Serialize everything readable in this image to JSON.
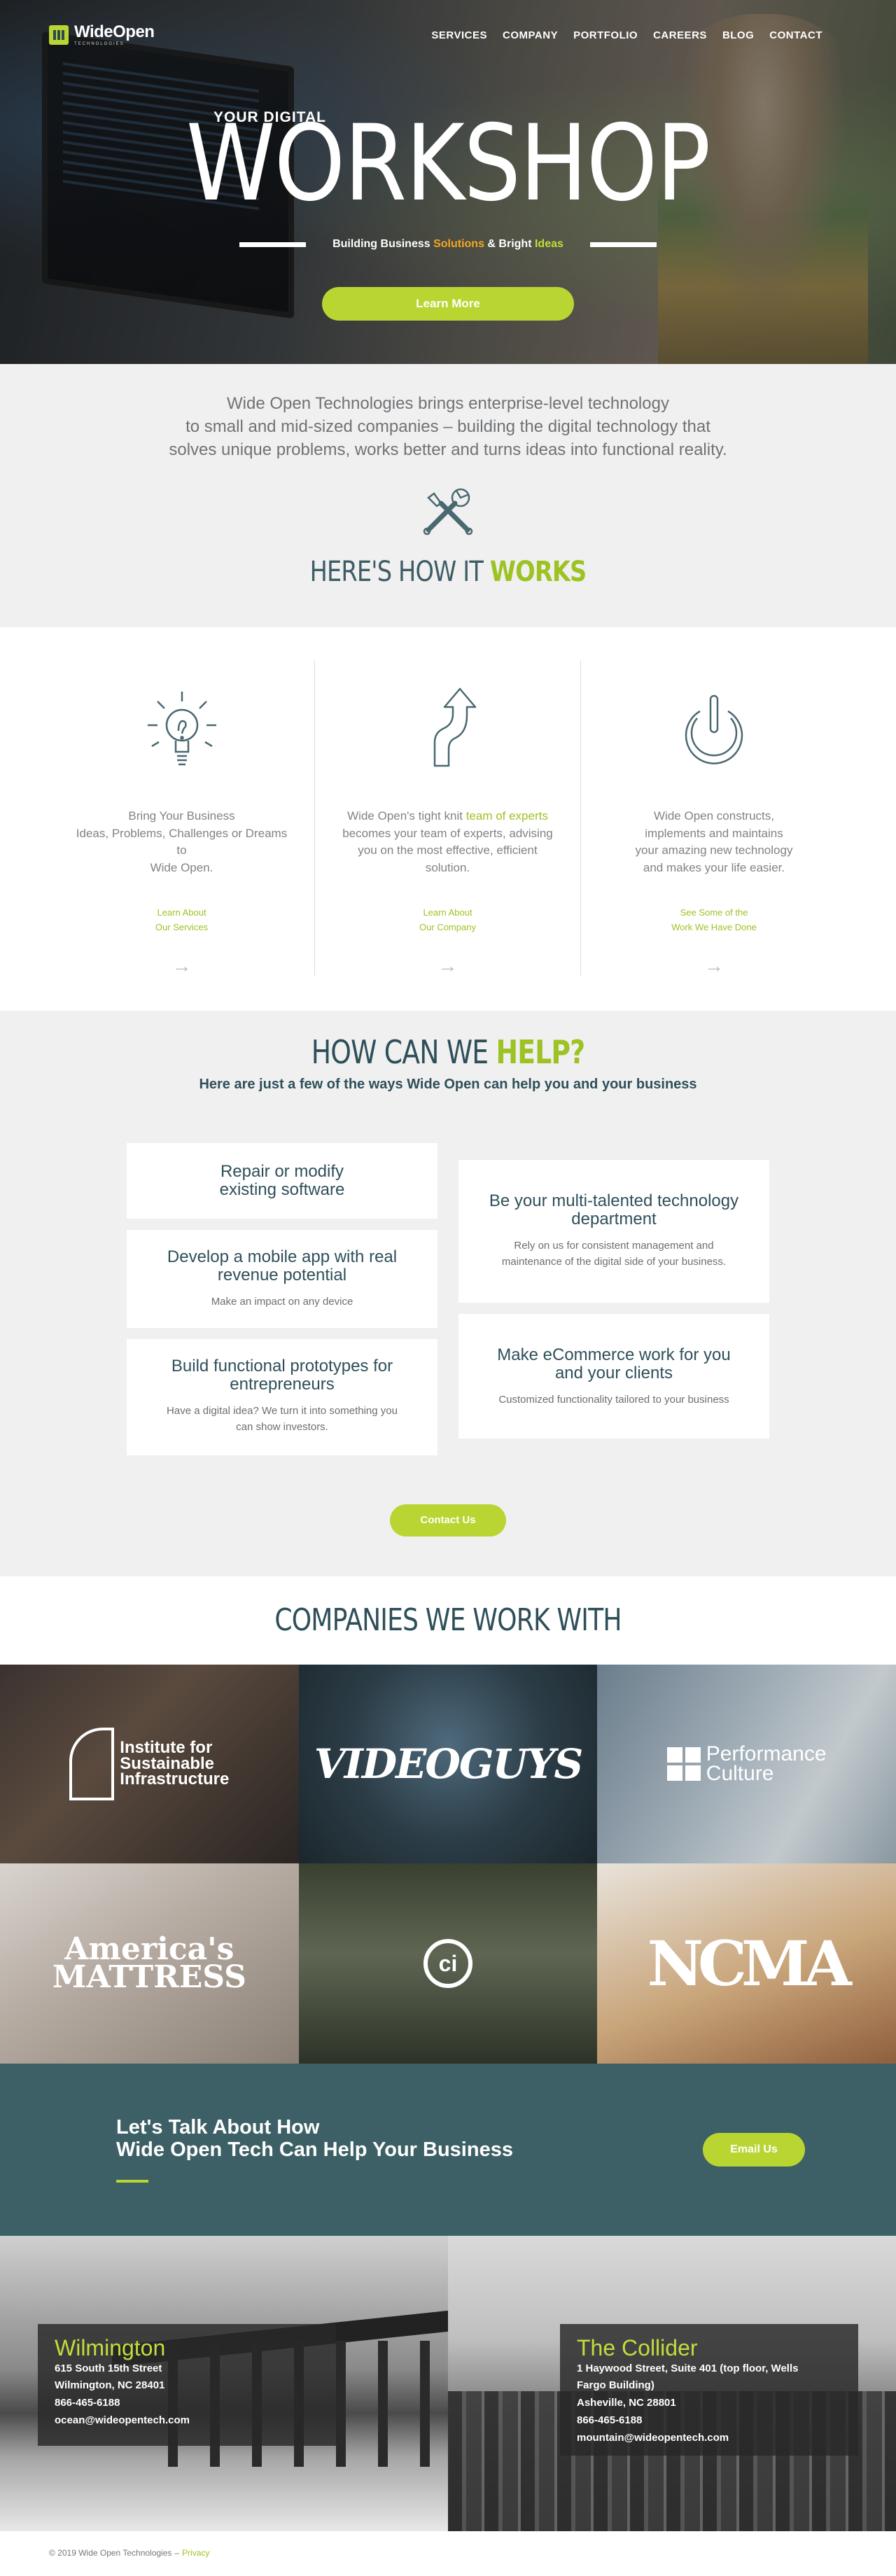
{
  "header": {
    "logo": {
      "brand": "WideOpen",
      "sub": "TECHNOLOGIES"
    },
    "nav": [
      "SERVICES",
      "COMPANY",
      "PORTFOLIO",
      "CAREERS",
      "BLOG",
      "CONTACT"
    ]
  },
  "hero": {
    "kicker": "YOUR DIGITAL",
    "title": "WORKSHOP",
    "tag_part1": "Building Business ",
    "tag_part2": "Solutions",
    "tag_part3": " & Bright ",
    "tag_part4": "Ideas",
    "button": "Learn More"
  },
  "intro": {
    "line1": "Wide Open Technologies brings enterprise-level technology",
    "line2": "to small and mid-sized companies – building the digital technology that",
    "line3": "solves unique problems, works better and turns ideas into functional reality.",
    "heading_plain": "HERE'S HOW IT ",
    "heading_hl": "WORKS"
  },
  "works": [
    {
      "text_line1": "Bring Your Business",
      "text_line2": "Ideas, Problems, Challenges or Dreams to",
      "text_line3": "Wide Open.",
      "link_line1": "Learn About",
      "link_line2": "Our Services"
    },
    {
      "text_pre": "Wide Open's tight knit ",
      "text_hl": "team of experts",
      "text_post": " becomes your team of experts, advising you on the most effective, efficient solution.",
      "link_line1": "Learn About",
      "link_line2": "Our Company"
    },
    {
      "text_line1": "Wide Open constructs,",
      "text_line2": "implements and maintains",
      "text_line3": "your amazing new technology",
      "text_line4": "and makes your life easier.",
      "link_line1": "See Some of the",
      "link_line2": "Work We Have Done"
    }
  ],
  "help": {
    "heading_plain": "HOW CAN WE ",
    "heading_hl": "HELP?",
    "subhead": "Here are just a few of the ways Wide Open can help you and your business",
    "cards_left": [
      {
        "title_line1": "Repair or modify",
        "title_line2": "existing software",
        "desc_line1": "",
        "desc_line2": ""
      },
      {
        "title_line1": "Develop a mobile app with real",
        "title_line2": "revenue potential",
        "desc_line1": "Make an impact on any device",
        "desc_line2": ""
      },
      {
        "title_line1": "Build functional prototypes for",
        "title_line2": "entrepreneurs",
        "desc_line1": "Have a digital idea? We turn it into something you",
        "desc_line2": "can show investors."
      }
    ],
    "cards_right": [
      {
        "title_line1": "Be your multi-talented technology",
        "title_line2": "department",
        "desc_line1": "Rely on us for consistent management and",
        "desc_line2": "maintenance of the digital side of your business."
      },
      {
        "title_line1": "Make eCommerce work for you",
        "title_line2": "and your clients",
        "desc_line1": "Customized functionality tailored to your business",
        "desc_line2": ""
      }
    ],
    "button": "Contact Us"
  },
  "companies": {
    "heading": "COMPANIES WE WORK WITH",
    "isi_line1": "Institute for",
    "isi_line2": "Sustainable",
    "isi_line3": "Infrastructure",
    "videoguys": "VIDEOGUYS",
    "pc_line1": "Performance",
    "pc_line2": "Culture",
    "am_line1": "America's",
    "am_line2": "MATTRESS",
    "ci": "ci",
    "ncma": "NCMA"
  },
  "cta": {
    "line1": "Let's Talk About How",
    "line2": "Wide Open Tech Can Help Your Business",
    "button": "Email Us"
  },
  "offices": [
    {
      "city": "Wilmington",
      "addr1": "615 South 15th Street",
      "addr2": "Wilmington, NC 28401",
      "phone": "866-465-6188",
      "email": "ocean@wideopentech.com"
    },
    {
      "city": "The Collider",
      "addr1": "1 Haywood Street, Suite 401 (top floor, Wells",
      "addr1b": "Fargo Building)",
      "addr2": "Asheville, NC 28801",
      "phone": "866-465-6188",
      "email": "mountain@wideopentech.com"
    }
  ],
  "footer": {
    "copyright": "© 2019 Wide Open Technologies",
    "sep": "–",
    "privacy": "Privacy"
  },
  "colors": {
    "accent": "#b9d532",
    "teal": "#3d6066",
    "heading": "#2e4f59",
    "orange": "#f5a623"
  }
}
